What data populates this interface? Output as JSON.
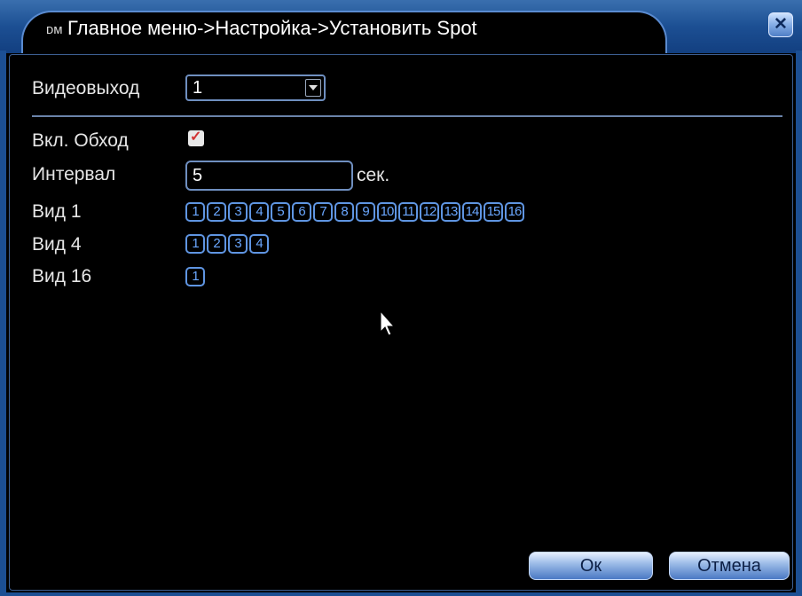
{
  "window": {
    "title_icon": "ᴅᴍ",
    "title": "Главное меню->Настройка->Установить Spot",
    "close_symbol": "✕"
  },
  "form": {
    "video_out_label": "Видеовыход",
    "video_out_value": "1",
    "tour_label": "Вкл. Обход",
    "tour_enabled": true,
    "tour_check": "✓",
    "interval_label": "Интервал",
    "interval_value": "5",
    "interval_unit": "сек.",
    "view1_label": "Вид 1",
    "view4_label": "Вид 4",
    "view16_label": "Вид 16"
  },
  "view1_channels": [
    "1",
    "2",
    "3",
    "4",
    "5",
    "6",
    "7",
    "8",
    "9",
    "10",
    "11",
    "12",
    "13",
    "14",
    "15",
    "16"
  ],
  "view4_channels": [
    "1",
    "2",
    "3",
    "4"
  ],
  "view16_channels": [
    "1"
  ],
  "buttons": {
    "ok": "Ок",
    "cancel": "Отмена"
  },
  "colors": {
    "frame": "#1c4f93",
    "channel": "#6aa7ff",
    "checkmark": "#d23333"
  }
}
